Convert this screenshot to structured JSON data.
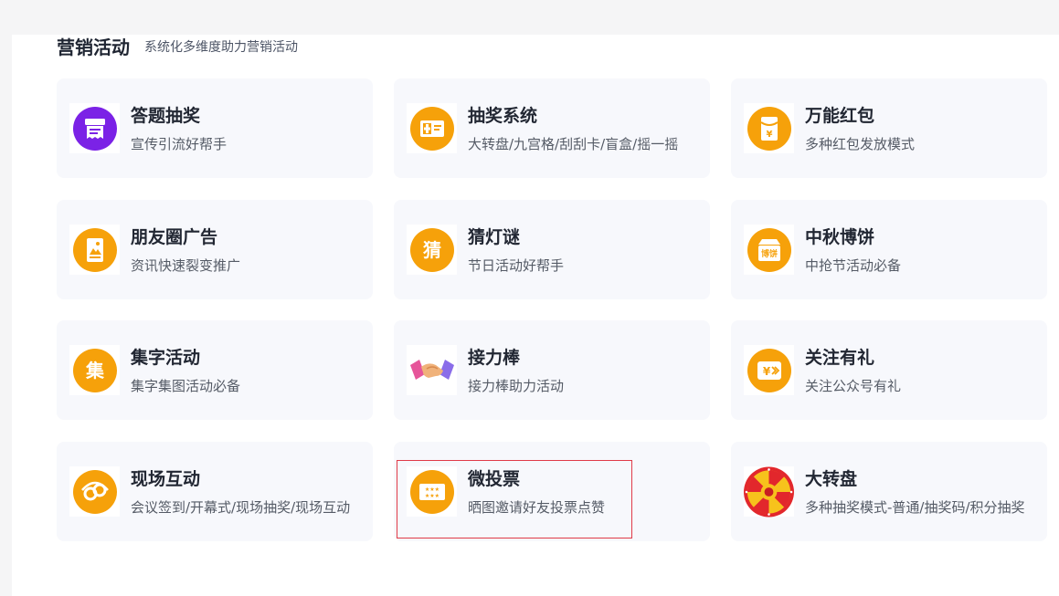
{
  "section": {
    "title": "营销活动",
    "subtitle": "系统化多维度助力营销活动"
  },
  "cards": [
    {
      "title": "答题抽奖",
      "desc": "宣传引流好帮手",
      "icon": "quiz-lottery-icon",
      "color": "#7b22e6"
    },
    {
      "title": "抽奖系统",
      "desc": "大转盘/九宫格/刮刮卡/盲盒/摇一摇",
      "icon": "lottery-system-icon",
      "color": "#f6a10a"
    },
    {
      "title": "万能红包",
      "desc": "多种红包发放模式",
      "icon": "red-packet-icon",
      "color": "#f6a10a"
    },
    {
      "title": "朋友圈广告",
      "desc": "资讯快速裂变推广",
      "icon": "moments-ad-icon",
      "color": "#f6a10a"
    },
    {
      "title": "猜灯谜",
      "desc": "节日活动好帮手",
      "icon": "lantern-riddle-icon",
      "color": "#f6a10a",
      "glyph": "猜"
    },
    {
      "title": "中秋博饼",
      "desc": "中抢节活动必备",
      "icon": "mooncake-dice-icon",
      "color": "#f6a10a",
      "glyph": "博饼"
    },
    {
      "title": "集字活动",
      "desc": "集字集图活动必备",
      "icon": "collect-words-icon",
      "color": "#f6a10a",
      "glyph": "集"
    },
    {
      "title": "接力棒",
      "desc": "接力棒助力活动",
      "icon": "handshake-icon",
      "color": "#f08a5d"
    },
    {
      "title": "关注有礼",
      "desc": "关注公众号有礼",
      "icon": "follow-gift-icon",
      "color": "#f6a10a",
      "glyph": "¥"
    },
    {
      "title": "现场互动",
      "desc": "会议签到/开幕式/现场抽奖/现场互动",
      "icon": "live-interaction-icon",
      "color": "#f6a10a"
    },
    {
      "title": "微投票",
      "desc": "晒图邀请好友投票点赞",
      "icon": "vote-icon",
      "color": "#f6a10a",
      "glyph": "★★★"
    },
    {
      "title": "大转盘",
      "desc": "多种抽奖模式-普通/抽奖码/积分抽奖",
      "icon": "prize-wheel-icon",
      "color": "#e2272c"
    }
  ]
}
